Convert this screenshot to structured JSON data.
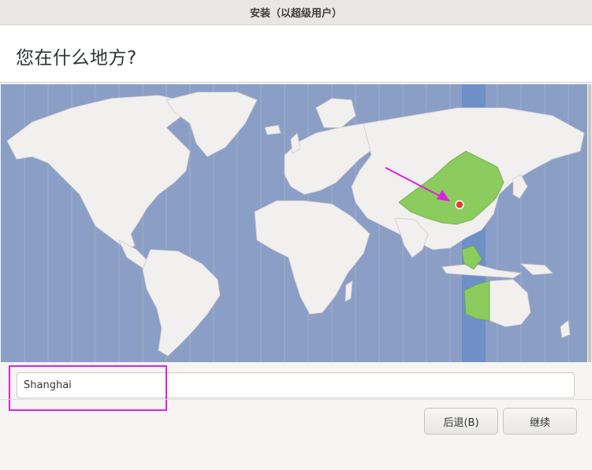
{
  "window": {
    "title": "安装（以超级用户）"
  },
  "header": {
    "title": "您在什么地方?"
  },
  "map": {
    "selected_timezone_band_color": "#6f8fc8",
    "land_color": "#f2efef",
    "selected_region_color": "#8ccb5e",
    "ocean_color": "#8b9fc6",
    "marker_color": "#e04030",
    "annotation_color": "#e020e0"
  },
  "timezone_input": {
    "value": "Shanghai"
  },
  "buttons": {
    "back_label": "后退(B)",
    "continue_label": "继续"
  }
}
